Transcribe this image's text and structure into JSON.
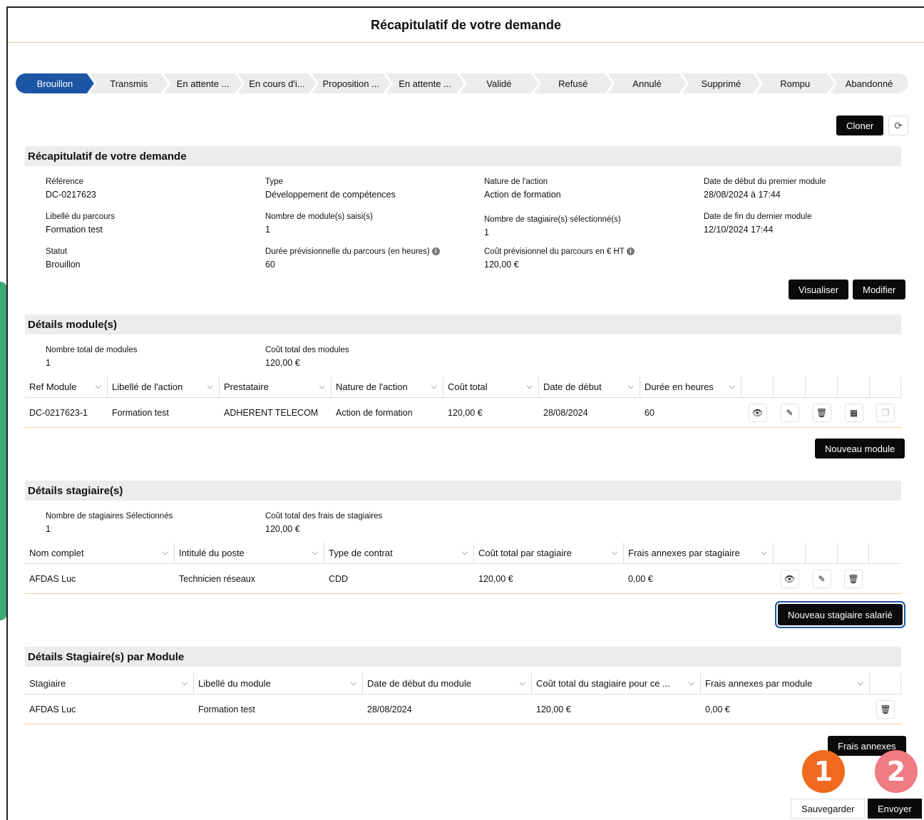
{
  "page": {
    "title": "Récapitulatif de votre demande"
  },
  "stepper": [
    "Brouillon",
    "Transmis",
    "En attente ...",
    "En cours d'i...",
    "Proposition ...",
    "En attente ...",
    "Validé",
    "Refusé",
    "Annulé",
    "Supprimé",
    "Rompu",
    "Abandonné"
  ],
  "actions": {
    "clone": "Cloner",
    "refresh_icon": "refresh-icon",
    "view": "Visualiser",
    "edit": "Modifier",
    "new_module": "Nouveau module",
    "new_trainee": "Nouveau stagiaire salarié",
    "extra_costs": "Frais annexes",
    "save": "Sauvegarder",
    "send": "Envoyer"
  },
  "summary": {
    "title": "Récapitulatif de votre demande",
    "fields": [
      {
        "label": "Référence",
        "value": "DC-0217623"
      },
      {
        "label": "Type",
        "value": "Développement de compétences"
      },
      {
        "label": "Nature de l'action",
        "value": "Action de formation"
      },
      {
        "label": "Date de début du premier module",
        "value": "28/08/2024 à 17:44"
      },
      {
        "label": "Libellé du parcours",
        "value": "Formation test"
      },
      {
        "label": "Nombre de module(s) saisi(s)",
        "value": "1"
      },
      {
        "label": "Nombre de stagiaire(s) sélectionné(s)",
        "value": "1"
      },
      {
        "label": "Date de fin du dernier module",
        "value": "12/10/2024 17:44"
      },
      {
        "label": "Statut",
        "value": "Brouillon"
      },
      {
        "label": "Durée prévisionnelle du parcours (en heures)",
        "value": "60"
      },
      {
        "label": "Coût prévisionnel du parcours en € HT",
        "value": "120,00 €"
      }
    ]
  },
  "modules": {
    "title": "Détails module(s)",
    "count_label": "Nombre total de modules",
    "count": "1",
    "cost_label": "Coût total des modules",
    "cost": "120,00 €",
    "columns": [
      "Ref Module",
      "Libellé de l'action",
      "Prestataire",
      "Nature de l'action",
      "Coût total",
      "Date de début",
      "Durée en heures"
    ],
    "rows": [
      [
        "DC-0217623-1",
        "Formation test",
        "ADHERENT TELECOM",
        "Action de formation",
        "120,00 €",
        "28/08/2024",
        "60"
      ]
    ]
  },
  "trainees": {
    "title": "Détails stagiaire(s)",
    "count_label": "Nombre de stagiaires Sélectionnés",
    "count": "1",
    "cost_label": "Coût total des frais de stagiaires",
    "cost": "120,00 €",
    "columns": [
      "Nom complet",
      "Intitulé du poste",
      "Type de contrat",
      "Coût total par stagiaire",
      "Frais annexes par stagiaire"
    ],
    "rows": [
      [
        "AFDAS Luc",
        "Technicien réseaux",
        "CDD",
        "120,00 €",
        "0,00 €"
      ]
    ]
  },
  "per_module": {
    "title": "Détails Stagiaire(s) par Module",
    "columns": [
      "Stagiaire",
      "Libellé du module",
      "Date de début du module",
      "Coût total du stagiaire pour ce ...",
      "Frais annexes par module"
    ],
    "rows": [
      [
        "AFDAS Luc",
        "Formation test",
        "28/08/2024",
        "120,00 €",
        "0,00 €"
      ]
    ]
  },
  "badges": {
    "one": "1",
    "two": "2"
  },
  "colors": {
    "active_step": "#1b56a5",
    "badge_one": "#ef6a1e",
    "badge_two": "#ee7b82",
    "accent": "#3daa77"
  }
}
